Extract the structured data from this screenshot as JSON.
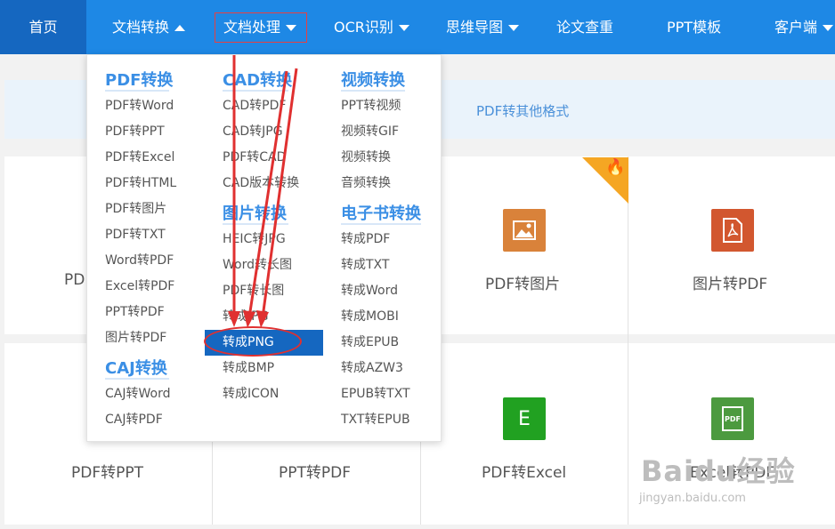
{
  "nav": {
    "home": "首页",
    "doc_convert": "文档转换",
    "doc_process": "文档处理",
    "ocr": "OCR识别",
    "mindmap": "思维导图",
    "paper_check": "论文查重",
    "ppt_template": "PPT模板",
    "client": "客户端"
  },
  "banner": {
    "text": "PDF转其他格式"
  },
  "cards": {
    "row1_partial": "PD",
    "pdf_to_image": "PDF转图片",
    "image_to_pdf": "图片转PDF",
    "pdf_to_ppt": "PDF转PPT",
    "ppt_to_pdf": "PPT转PDF",
    "pdf_to_excel": "PDF转Excel",
    "excel_to_pdf": "Excel转PDF",
    "excel_icon_letter": "E",
    "pdf_icon_letter": "PDF"
  },
  "dropdown": {
    "pdf": {
      "title": "PDF转换",
      "items": [
        "PDF转Word",
        "PDF转PPT",
        "PDF转Excel",
        "PDF转HTML",
        "PDF转图片",
        "PDF转TXT",
        "Word转PDF",
        "Excel转PDF",
        "PPT转PDF",
        "图片转PDF"
      ]
    },
    "caj": {
      "title": "CAJ转换",
      "items": [
        "CAJ转Word",
        "CAJ转PDF"
      ]
    },
    "cad": {
      "title": "CAD转换",
      "items": [
        "CAD转PDF",
        "CAD转JPG",
        "PDF转CAD",
        "CAD版本转换"
      ]
    },
    "image": {
      "title": "图片转换",
      "items": [
        "HEIC转JPG",
        "Word转长图",
        "PDF转长图",
        "转成JPG",
        "转成PNG",
        "转成BMP",
        "转成ICON"
      ]
    },
    "video": {
      "title": "视频转换",
      "items": [
        "PPT转视频",
        "视频转GIF",
        "视频转换",
        "音频转换"
      ]
    },
    "ebook": {
      "title": "电子书转换",
      "items": [
        "转成PDF",
        "转成TXT",
        "转成Word",
        "转成MOBI",
        "转成EPUB",
        "转成AZW3",
        "EPUB转TXT",
        "TXT转EPUB"
      ]
    }
  },
  "watermark": {
    "brand": "Baidu经验",
    "url": "jingyan.baidu.com"
  },
  "colors": {
    "nav": "#1e88e5",
    "nav_active": "#1567c0",
    "title_blue": "#3b8fe5",
    "highlight_red": "#e03030",
    "hot_badge": "#f5a623"
  }
}
